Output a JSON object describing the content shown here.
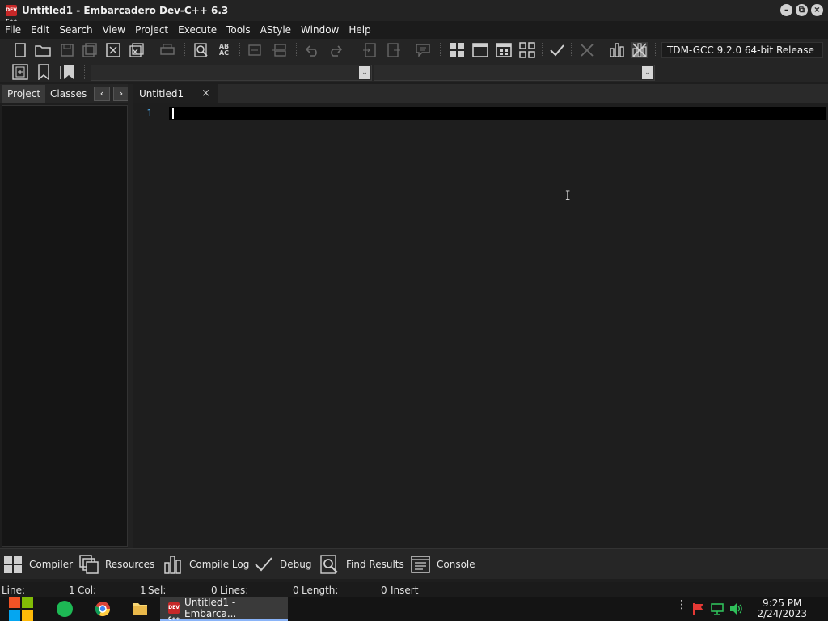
{
  "window": {
    "title": "Untitled1 - Embarcadero Dev-C++ 6.3",
    "app_icon_text": "DEV C++",
    "minimize": "–",
    "restore": "⧉",
    "close": "×"
  },
  "menu": [
    "File",
    "Edit",
    "Search",
    "View",
    "Project",
    "Execute",
    "Tools",
    "AStyle",
    "Window",
    "Help"
  ],
  "toolbar": {
    "compiler_select": "TDM-GCC 9.2.0 64-bit Release",
    "find_replace_label_top": "AB",
    "find_replace_label_bottom": "AC"
  },
  "left_panel": {
    "tabs": [
      "Project",
      "Classes"
    ],
    "prev": "‹",
    "next": "›"
  },
  "editor": {
    "tab_label": "Untitled1",
    "tab_close": "×",
    "line_numbers": [
      "1"
    ]
  },
  "dock": [
    "Compiler",
    "Resources",
    "Compile Log",
    "Debug",
    "Find Results",
    "Console"
  ],
  "status": {
    "line_label": "Line:",
    "line_value": "1",
    "col_label": "Col:",
    "col_value": "1",
    "sel_label": "Sel:",
    "sel_value": "0",
    "lines_label": "Lines:",
    "lines_value": "0",
    "length_label": "Length:",
    "length_value": "0",
    "mode": "Insert"
  },
  "taskbar": {
    "app_label": "Untitled1 - Embarca...",
    "time": "9:25 PM",
    "date": "2/24/2023"
  },
  "colors": {
    "line_number": "#4aa3df",
    "background": "#1e1e1e",
    "current_line": "#000000"
  }
}
